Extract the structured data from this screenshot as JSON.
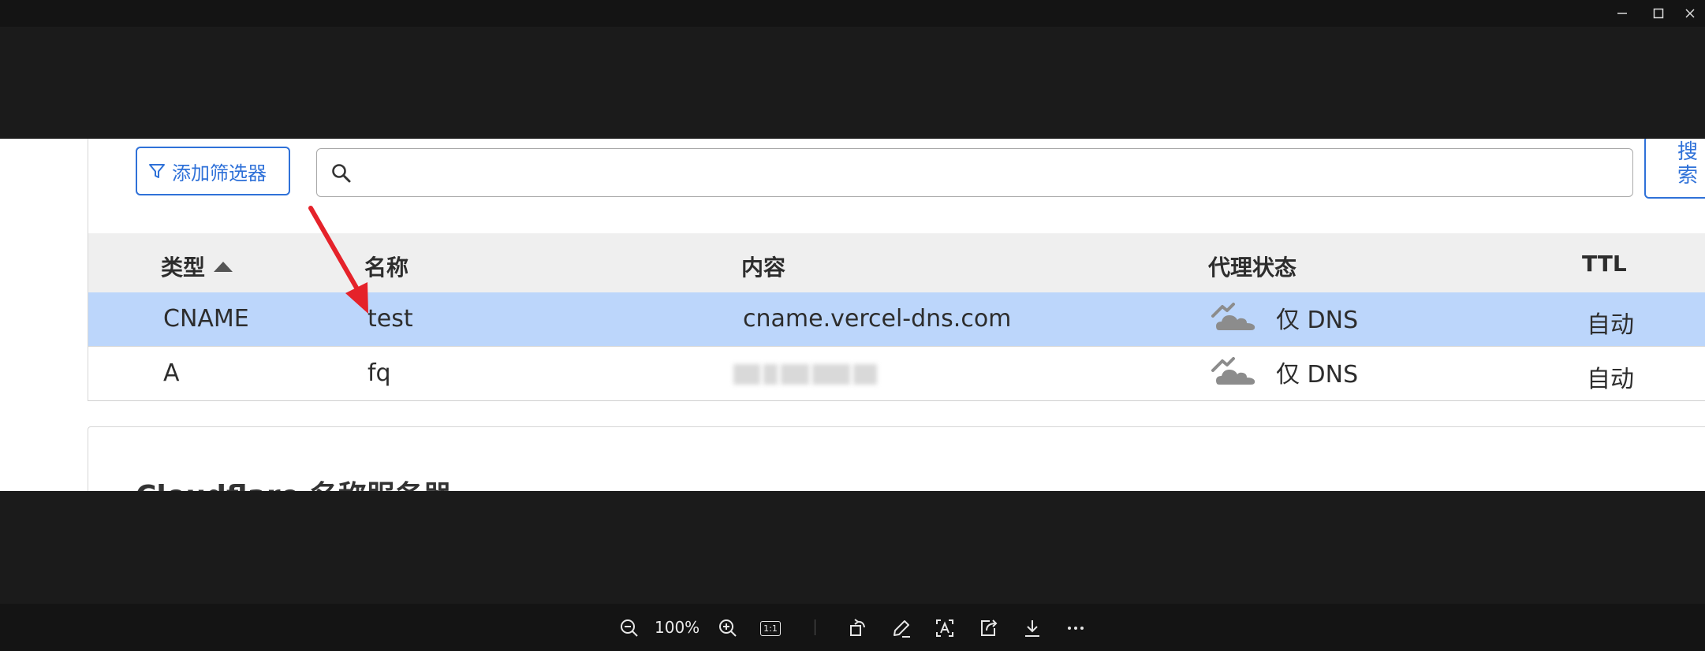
{
  "filter": {
    "label": "添加筛选器"
  },
  "search": {
    "placeholder": "",
    "value": "",
    "button_label": "搜索"
  },
  "table": {
    "columns": [
      "类型",
      "名称",
      "内容",
      "代理状态",
      "TTL"
    ],
    "sort_column": "类型",
    "rows": [
      {
        "type": "CNAME",
        "name": "test",
        "content": "cname.vercel-dns.com",
        "proxy": "仅 DNS",
        "ttl": "自动",
        "selected": true
      },
      {
        "type": "A",
        "name": "fq",
        "content": "",
        "proxy": "仅 DNS",
        "ttl": "自动",
        "selected": false
      }
    ]
  },
  "nameservers": {
    "title": "Cloudflare 名称服务器"
  },
  "viewer": {
    "zoom": "100%",
    "actual_size_label": "1:1"
  },
  "colors": {
    "accent": "#2f71d8",
    "selected_row": "#bcd6fb",
    "annotation_arrow": "#e5222a",
    "cloud": "#8c8c8c"
  },
  "icons": [
    "filter-icon",
    "search-icon",
    "sort-up-icon",
    "cloud-dns-only-icon",
    "arrow-annotation",
    "zoom-out-icon",
    "zoom-in-icon",
    "actual-size-icon",
    "rotate-icon",
    "edit-icon",
    "text-recognition-icon",
    "share-icon",
    "download-icon",
    "more-icon",
    "minimize-icon",
    "maximize-icon",
    "close-icon"
  ]
}
